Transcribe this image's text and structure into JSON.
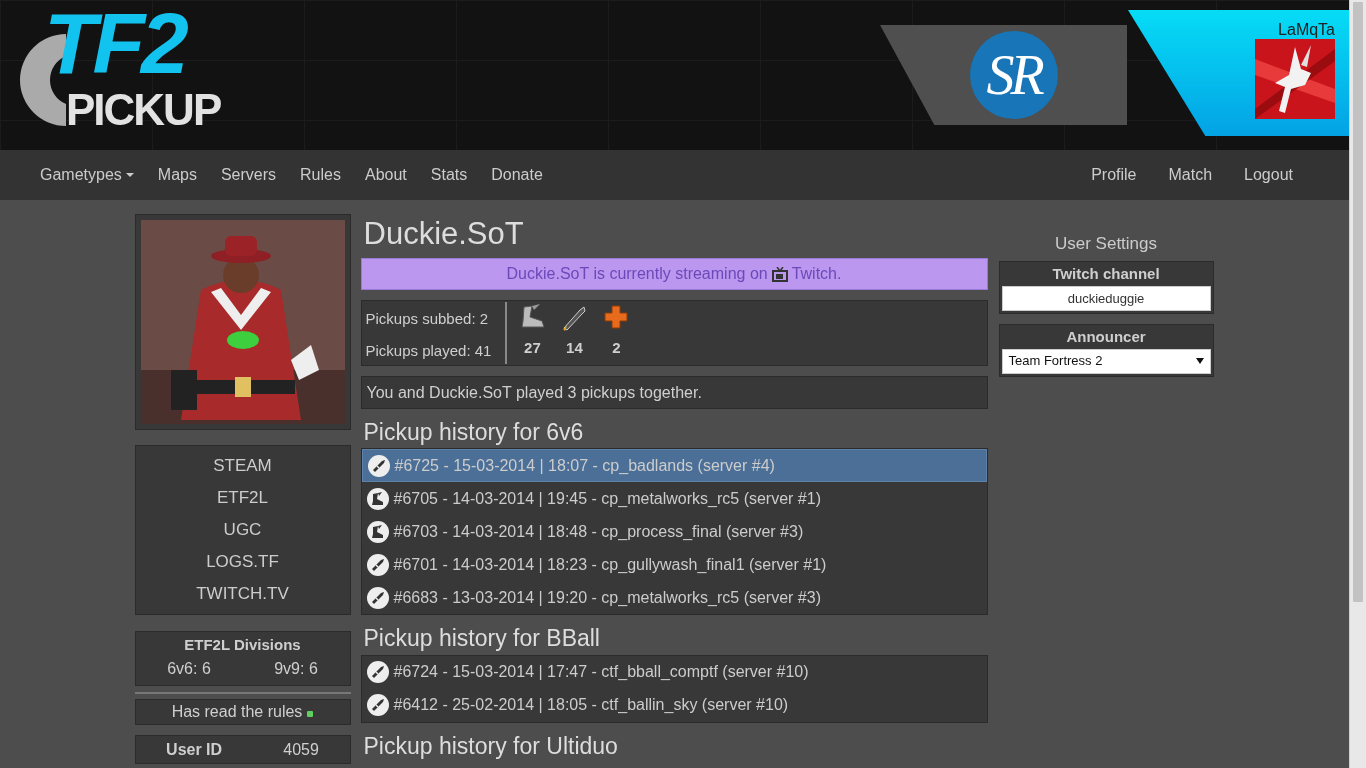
{
  "header": {
    "logo": {
      "top": "TF2",
      "bottom": "PICKUP"
    },
    "sponsor": {
      "text": "SR"
    },
    "user": {
      "name": "LaMqTa"
    }
  },
  "nav": {
    "left": [
      {
        "label": "Gametypes",
        "dropdown": true
      },
      {
        "label": "Maps",
        "dropdown": false
      },
      {
        "label": "Servers",
        "dropdown": false
      },
      {
        "label": "Rules",
        "dropdown": false
      },
      {
        "label": "About",
        "dropdown": false
      },
      {
        "label": "Stats",
        "dropdown": false
      },
      {
        "label": "Donate",
        "dropdown": false
      }
    ],
    "right": [
      {
        "label": "Profile",
        "dropdown": false
      },
      {
        "label": "Match",
        "dropdown": false
      },
      {
        "label": "Logout",
        "dropdown": false
      }
    ]
  },
  "profile": {
    "links": [
      "STEAM",
      "ETF2L",
      "UGC",
      "LOGS.TF",
      "TWITCH.TV"
    ],
    "divisions": {
      "title": "ETF2L Divisions",
      "items": [
        "6v6: 6",
        "9v9: 6"
      ]
    },
    "rules": {
      "label": "Has read the rules",
      "read": true
    },
    "user_id": {
      "label": "User ID",
      "value": "4059"
    }
  },
  "player": {
    "name": "Duckie.SoT",
    "stream": {
      "text": "Duckie.SoT is currently streaming on",
      "link": "Twitch."
    },
    "stats": {
      "subbed": "Pickups subbed: 2",
      "played": "Pickups played: 41",
      "classes": [
        {
          "kind": "scout",
          "count": "27"
        },
        {
          "kind": "soldier",
          "count": "14"
        },
        {
          "kind": "medic",
          "count": "2"
        }
      ]
    },
    "together": "You and Duckie.SoT played 3 pickups together."
  },
  "history": [
    {
      "title": "Pickup history for 6v6",
      "rows": [
        {
          "kind": "soldier",
          "text": "#6725 - 15-03-2014 | 18:07 - cp_badlands (server #4)",
          "selected": true
        },
        {
          "kind": "scout",
          "text": "#6705 - 14-03-2014 | 19:45 - cp_metalworks_rc5 (server #1)",
          "selected": false
        },
        {
          "kind": "scout",
          "text": "#6703 - 14-03-2014 | 18:48 - cp_process_final (server #3)",
          "selected": false
        },
        {
          "kind": "soldier",
          "text": "#6701 - 14-03-2014 | 18:23 - cp_gullywash_final1 (server #1)",
          "selected": false
        },
        {
          "kind": "soldier",
          "text": "#6683 - 13-03-2014 | 19:20 - cp_metalworks_rc5 (server #3)",
          "selected": false
        }
      ]
    },
    {
      "title": "Pickup history for BBall",
      "rows": [
        {
          "kind": "soldier",
          "text": "#6724 - 15-03-2014 | 17:47 - ctf_bball_comptf (server #10)",
          "selected": false
        },
        {
          "kind": "soldier",
          "text": "#6412 - 25-02-2014 | 18:05 - ctf_ballin_sky (server #10)",
          "selected": false
        }
      ]
    },
    {
      "title": "Pickup history for Ultiduo"
    }
  ],
  "settings": {
    "title": "User Settings",
    "twitch": {
      "label": "Twitch channel",
      "value": "duckieduggie"
    },
    "announcer": {
      "label": "Announcer",
      "value": "Team Fortress 2"
    }
  }
}
